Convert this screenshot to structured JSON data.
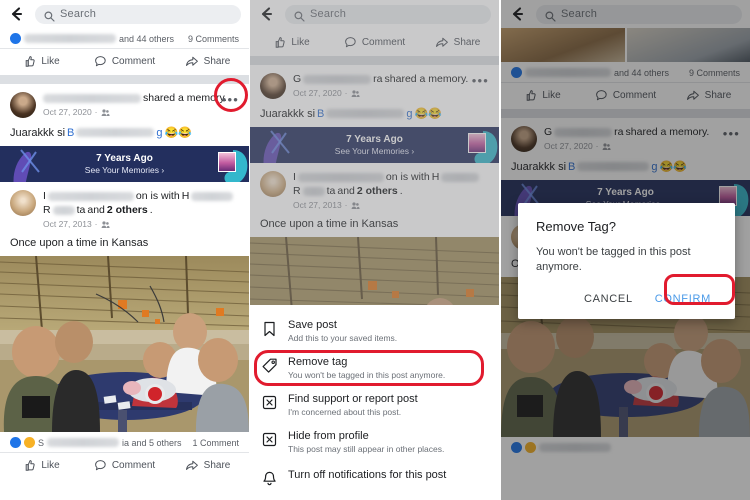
{
  "meta": {
    "app": "Facebook mobile app",
    "flow": "Remove tag from a post — three step screenshot sequence",
    "accent_red": "#e11b2e",
    "banner_navy": "#232f5e",
    "link_blue": "#2f6fd0",
    "confirm_blue": "#4a9ae8"
  },
  "search": {
    "placeholder": "Search",
    "back_icon": "back-arrow-icon",
    "icon": "search-icon"
  },
  "actions": {
    "like": "Like",
    "comment": "Comment",
    "share": "Share"
  },
  "post_above": {
    "reactions_text": "and 44 others",
    "comments_text": "9 Comments",
    "name_redacted": ""
  },
  "post_bottom": {
    "reactions_prefix": "S",
    "reactions_text": "ia and 5 others",
    "comments_text": "1 Comment"
  },
  "memory_post": {
    "author_prefix": "G",
    "author_suffix": "ra",
    "headline_tail": "shared a memory.",
    "date": "Oct 27, 2020",
    "separator": "·",
    "audience_icon": "friends-icon",
    "more_icon": "three-dots-icon",
    "caption_prefix": "Juarakkk si",
    "caption_name_start": "B",
    "caption_name_tail": "g",
    "caption_emoji": "😂😂"
  },
  "memories_banner": {
    "title": "7 Years Ago",
    "subtitle": "See Your Memories",
    "chevron": "›"
  },
  "inner_post": {
    "author_initial": "I",
    "headline_mid": "on is with",
    "tagged_initial": "H",
    "tagged_second": "R",
    "tagged_second_tail": "ta",
    "and_text": "and",
    "others_text": "2 others",
    "period": ".",
    "date": "Oct 27, 2013",
    "separator": "·",
    "caption": "Once upon a time in Kansas"
  },
  "menu": {
    "items": [
      {
        "icon": "bookmark-icon",
        "title": "Save post",
        "subtitle": "Add this to your saved items.",
        "highlighted": false
      },
      {
        "icon": "tag-icon",
        "title": "Remove tag",
        "subtitle": "You won't be tagged in this post anymore.",
        "highlighted": true
      },
      {
        "icon": "report-x-icon",
        "title": "Find support or report post",
        "subtitle": "I'm concerned about this post.",
        "highlighted": false
      },
      {
        "icon": "hide-x-icon",
        "title": "Hide from profile",
        "subtitle": "This post may still appear in other places.",
        "highlighted": false
      },
      {
        "icon": "bell-icon",
        "title": "Turn off notifications for this post",
        "subtitle": "",
        "highlighted": false
      }
    ]
  },
  "dialog": {
    "title": "Remove Tag?",
    "body": "You won't be tagged in this post anymore.",
    "cancel": "CANCEL",
    "confirm": "CONFIRM"
  }
}
